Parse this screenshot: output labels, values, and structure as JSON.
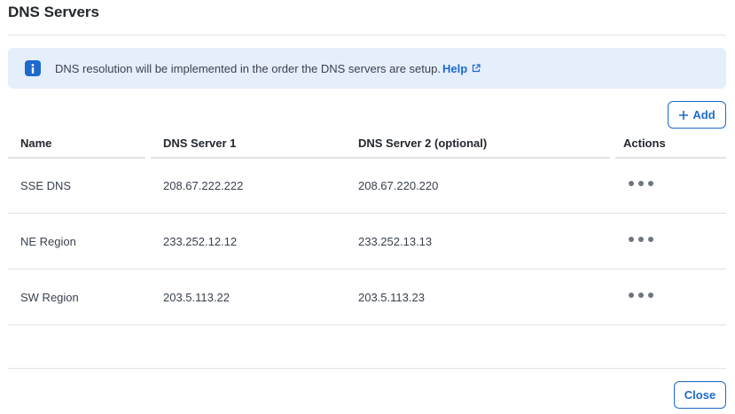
{
  "dialog": {
    "title": "DNS Servers"
  },
  "banner": {
    "icon": "info-icon",
    "text": "DNS resolution will be implemented in the order the DNS servers are setup.",
    "help_label": "Help",
    "help_icon": "external-link-icon",
    "color": "#1d69cc",
    "background": "#e5eefb"
  },
  "toolbar": {
    "add_label": "Add",
    "add_icon": "plus-icon"
  },
  "table": {
    "columns": [
      "Name",
      "DNS Server 1",
      "DNS Server 2 (optional)",
      "Actions"
    ],
    "rows": [
      {
        "name": "SSE DNS",
        "dns1": "208.67.222.222",
        "dns2": "208.67.220.220",
        "actions_icon": "more-horizontal-icon"
      },
      {
        "name": "NE Region",
        "dns1": "233.252.12.12",
        "dns2": "233.252.13.13",
        "actions_icon": "more-horizontal-icon"
      },
      {
        "name": "SW Region",
        "dns1": "203.5.113.22",
        "dns2": "203.5.113.23",
        "actions_icon": "more-horizontal-icon"
      }
    ]
  },
  "footer": {
    "close_label": "Close"
  }
}
